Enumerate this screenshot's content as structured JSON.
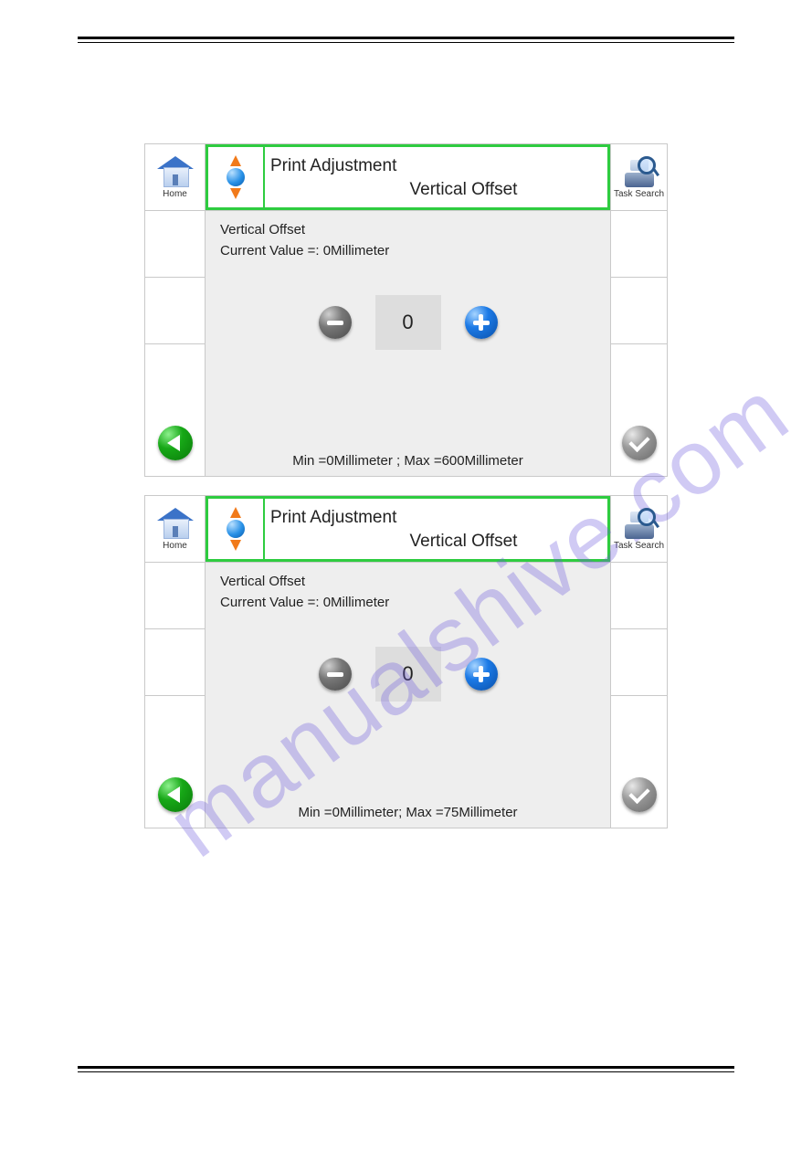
{
  "watermark": "manualshive.com",
  "panels": [
    {
      "header": {
        "title": "Print Adjustment",
        "subtitle": "Vertical Offset"
      },
      "left_nav": {
        "home_label": "Home"
      },
      "right_nav": {
        "task_label": "Task Search"
      },
      "body": {
        "param_label": "Vertical Offset",
        "current_value_label": "Current Value =: 0Millimeter",
        "stepper_value": "0"
      },
      "footer": {
        "minmax": "Min =0Millimeter ; Max =600Millimeter"
      }
    },
    {
      "header": {
        "title": "Print Adjustment",
        "subtitle": "Vertical Offset"
      },
      "left_nav": {
        "home_label": "Home"
      },
      "right_nav": {
        "task_label": "Task Search"
      },
      "body": {
        "param_label": "Vertical Offset",
        "current_value_label": "Current Value =: 0Millimeter",
        "stepper_value": "0"
      },
      "footer": {
        "minmax": "Min =0Millimeter;  Max =75Millimeter"
      }
    }
  ]
}
